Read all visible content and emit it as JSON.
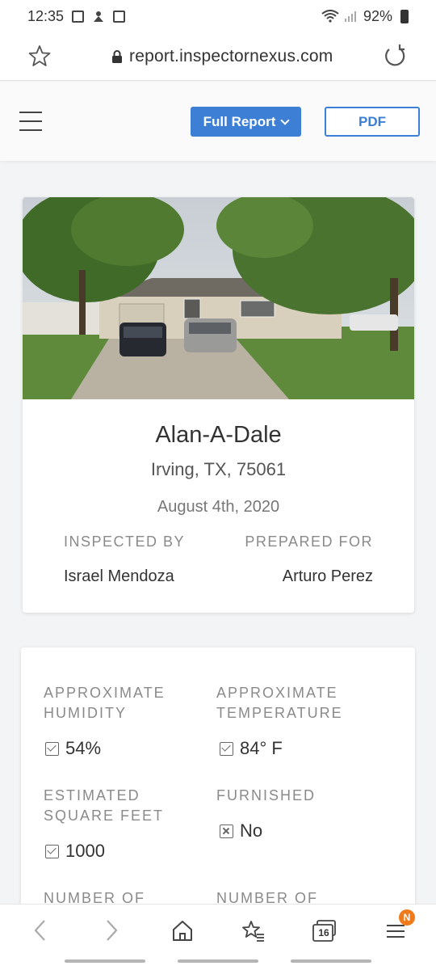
{
  "status_bar": {
    "time": "12:35",
    "battery": "92%"
  },
  "browser": {
    "url": "report.inspectornexus.com"
  },
  "header": {
    "report_button": "Full Report",
    "pdf_button": "PDF"
  },
  "property": {
    "name": "Alan-A-Dale",
    "city": "Irving, TX, 75061",
    "date": "August 4th, 2020",
    "inspected_by_label": "INSPECTED BY",
    "inspected_by": "Israel Mendoza",
    "prepared_for_label": "PREPARED FOR",
    "prepared_for": "Arturo Perez"
  },
  "details": {
    "humidity_label_1": "APPROXIMATE",
    "humidity_label_2": "HUMIDITY",
    "humidity": "54%",
    "temperature_label_1": "APPROXIMATE",
    "temperature_label_2": "TEMPERATURE",
    "temperature": "84° F",
    "sqft_label_1": "ESTIMATED",
    "sqft_label_2": "SQUARE FEET",
    "sqft": "1000",
    "furnished_label": "FURNISHED",
    "furnished": "No",
    "number_of_1": "NUMBER OF",
    "number_of_2": "NUMBER OF"
  },
  "bottom_nav": {
    "tabs_count": "16",
    "menu_badge": "N"
  }
}
